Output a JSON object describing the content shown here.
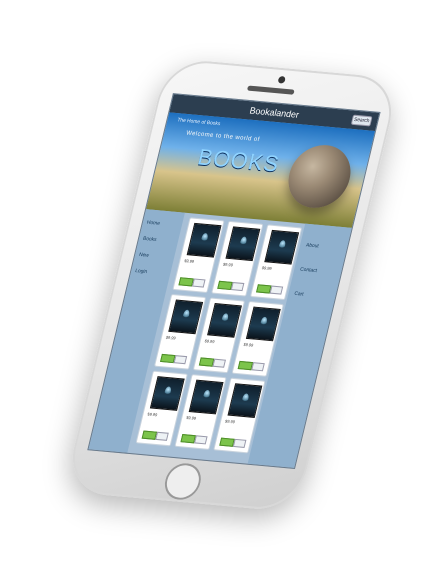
{
  "app": {
    "title": "Bookalander"
  },
  "topbar": {
    "button_label": "Search"
  },
  "hero": {
    "tagline": "The Home of Books",
    "welcome": "Welcome to the world of",
    "big_word": "BOOKS"
  },
  "left_nav": {
    "items": [
      "Home",
      "Books",
      "New",
      "Login"
    ]
  },
  "right_nav": {
    "items": [
      "About",
      "Contact",
      "Cart"
    ]
  },
  "cards": [
    {
      "title": "Book 1",
      "price": "$9.99"
    },
    {
      "title": "Book 2",
      "price": "$9.99"
    },
    {
      "title": "Book 3",
      "price": "$9.99"
    },
    {
      "title": "Book 4",
      "price": "$9.99"
    },
    {
      "title": "Book 5",
      "price": "$9.99"
    },
    {
      "title": "Book 6",
      "price": "$9.99"
    },
    {
      "title": "Book 7",
      "price": "$9.99"
    },
    {
      "title": "Book 8",
      "price": "$9.99"
    },
    {
      "title": "Book 9",
      "price": "$9.99"
    }
  ]
}
